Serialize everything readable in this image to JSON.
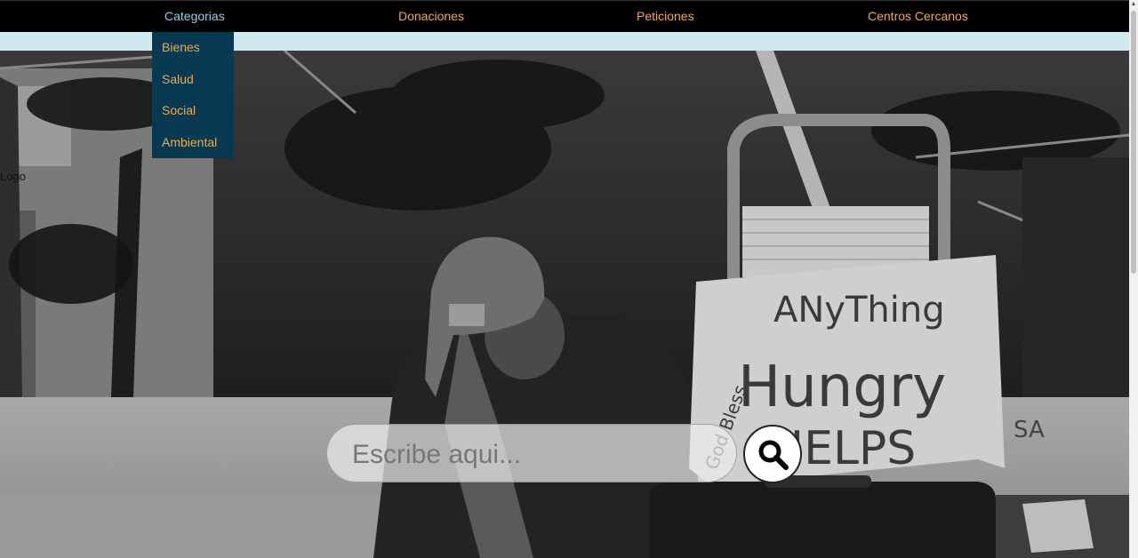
{
  "nav": {
    "items": [
      {
        "label": "Categorias"
      },
      {
        "label": "Donaciones"
      },
      {
        "label": "Peticiones"
      },
      {
        "label": "Centros Cercanos"
      }
    ]
  },
  "dropdown": {
    "items": [
      {
        "label": "Bienes"
      },
      {
        "label": "Salud"
      },
      {
        "label": "Social"
      },
      {
        "label": "Ambiental"
      }
    ]
  },
  "logo": {
    "alt_text": "Logo"
  },
  "hero": {
    "sign_lines": [
      "ANyThing",
      "Hungry",
      "HELPS"
    ],
    "sign_side_text": "God Bless",
    "bg_text": "SA"
  },
  "search": {
    "placeholder": "Escribe aqui...",
    "button_icon": "search-icon"
  },
  "colors": {
    "nav_bg": "#000000",
    "nav_link": "#f0a94a",
    "nav_active": "#8fd1e6",
    "dropdown_bg": "#073a52",
    "strip": "#d0e9ee"
  }
}
